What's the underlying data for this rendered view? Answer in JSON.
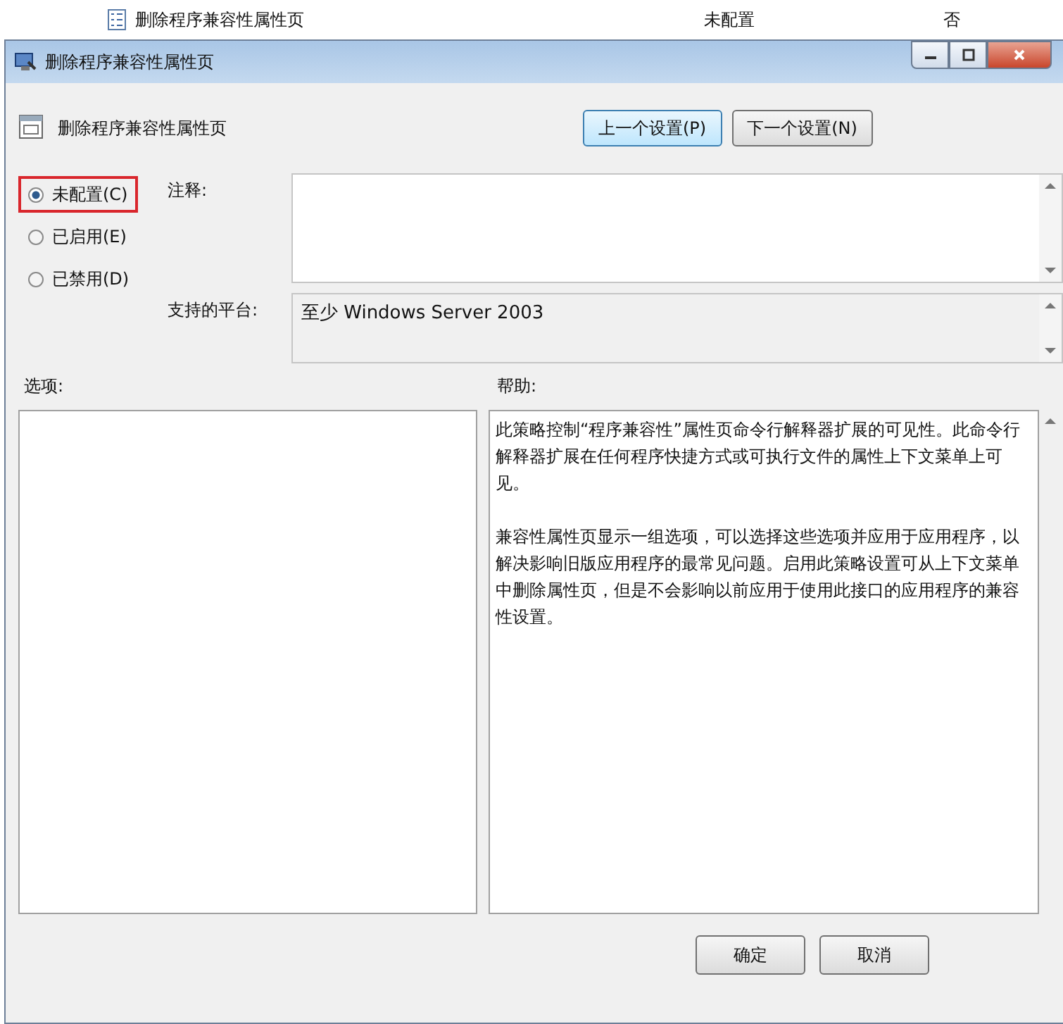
{
  "background_row": {
    "name": "删除程序兼容性属性页",
    "state": "未配置",
    "column_3": "否"
  },
  "window": {
    "title": "删除程序兼容性属性页"
  },
  "header": {
    "title": "删除程序兼容性属性页",
    "buttons": [
      "上一个设置(P)",
      "下一个设置(N)"
    ]
  },
  "options": [
    {
      "label": "未配置(C)",
      "selected": true,
      "highlighted": true
    },
    {
      "label": "已启用(E)",
      "selected": false,
      "highlighted": false
    },
    {
      "label": "已禁用(D)",
      "selected": false,
      "highlighted": false
    }
  ],
  "comment": {
    "label": "注释:"
  },
  "platform": {
    "label": "支持的平台:",
    "value": "至少 Windows Server 2003"
  },
  "options_label": "选项:",
  "help": {
    "label": "帮助:",
    "paragraphs": [
      "此策略控制“程序兼容性”属性页命令行解释器扩展的可见性。此命令行解释器扩展在任何程序快捷方式或可执行文件的属性上下文菜单上可见。",
      "兼容性属性页显示一组选项，可以选择这些选项并应用于应用程序，以解决影响旧版应用程序的最常见问题。启用此策略设置可从上下文菜单中删除属性页，但是不会影响以前应用于使用此接口的应用程序的兼容性设置。"
    ]
  },
  "footer_buttons": [
    "确定",
    "取消"
  ]
}
